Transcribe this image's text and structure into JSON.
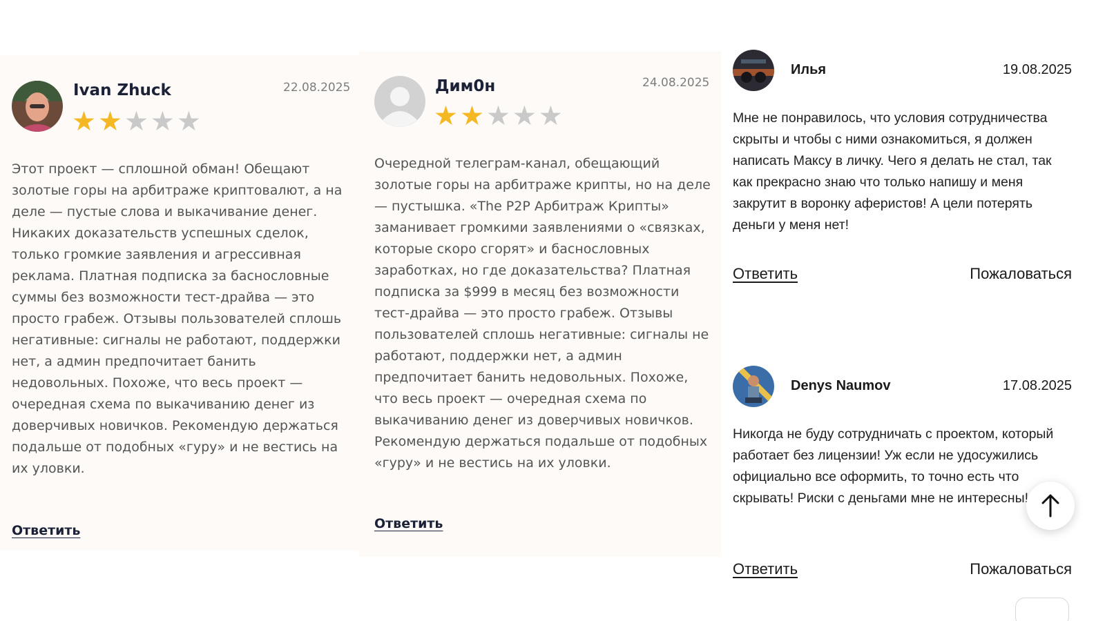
{
  "reviews_left": [
    {
      "author": "Ivan Zhuck",
      "date": "22.08.2025",
      "rating": 2,
      "max_rating": 5,
      "text": "Этот проект — сплошной обман! Обещают золотые горы на арбитраже криптовалют, а на деле — пустые слова и выкачивание денег. Никаких доказательств успешных сделок, только громкие заявления и агрессивная реклама. Платная подписка за басносл­овные суммы без возможности тест-драйва — это просто грабеж. Отзывы пользователей сплошь негативные: сигналы не работают, поддержки нет, а админ предпочитает банить недовольных. Похоже, что весь проект — очередная схема по выкачиванию денег из доверчивых новичков. Рекомендую держаться подальше от подобных «гуру» и не вестись на их уловки.",
      "reply_label": "Ответить"
    },
    {
      "author": "Дим0н",
      "date": "24.08.2025",
      "rating": 2,
      "max_rating": 5,
      "text": "Очередной телеграм-канал, обещающий золотые горы на арбитраже крипты, но на деле — пустышка. «The P2P Арбитраж Крипты» заманивает громкими заявлениями о «связках, которые скоро сгорят» и баснословных заработках, но где доказательства? Платная подписка за $999 в месяц без возможности тест-драйва — это просто грабеж. Отзывы пользователей сплошь негативные: сигналы не работают, поддержки нет, а админ предпочитает банить недовольных. Похоже, что весь проект — очередная схема по выкачиванию денег из доверчивых новичков. Рекомендую держаться подальше от подобных «гуру» и не вестись на их уловки.",
      "reply_label": "Ответить"
    }
  ],
  "reviews_right": [
    {
      "author": "Илья",
      "date": "19.08.2025",
      "text": "Мне не понравилось, что условия сотрудничества скрыты и чтобы с ними ознакомиться, я должен написать Максу в личку. Чего я делать не стал, так как прекрасно знаю что только напишу и меня закрутит в воронку аферистов! А цели потерять деньги у меня нет!",
      "reply_label": "Ответить",
      "complain_label": "Пожаловаться"
    },
    {
      "author": "Denys Naumov",
      "date": "17.08.2025",
      "text": "Никогда не буду сотрудничать с проектом, который работает без лицензии! Уж если не удосужились официально все оформить, то точно есть что скрывать! Риски с деньгами мне не интересны!",
      "reply_label": "Ответить",
      "complain_label": "Пожаловаться"
    }
  ],
  "icons": {
    "star_filled": "star-filled-icon",
    "star_empty": "star-empty-icon",
    "scroll_top": "arrow-up-icon",
    "default_avatar": "user-placeholder-icon"
  },
  "colors": {
    "star_on": "#f5b825",
    "star_off": "#c9c9c9",
    "card_bg": "#fdfaf7"
  }
}
